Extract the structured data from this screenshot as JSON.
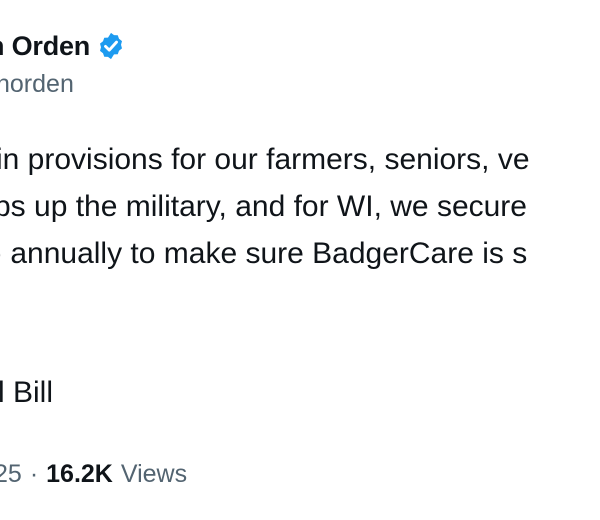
{
  "author": {
    "display_name": "n Orden",
    "handle": "norden",
    "verified_icon": "verified-badge-icon",
    "verified_color": "#1d9bf0"
  },
  "tweet": {
    "lines": [
      "in provisions for our farmers, seniors, ve",
      "ps up the military, and for WI, we secure",
      ") annually to make sure BadgerCare is s"
    ],
    "link_text": "l Bill"
  },
  "meta": {
    "date_fragment": "25",
    "separator": "·",
    "views_count": "16.2K",
    "views_label": "Views"
  }
}
